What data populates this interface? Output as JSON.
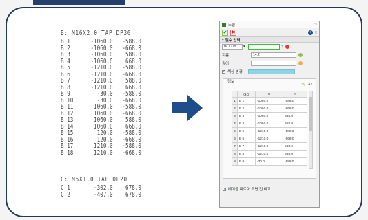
{
  "drawing": {
    "title": "B: M16X2.0 TAP DP30",
    "rows": [
      {
        "id": "B 1",
        "x": "-1060.0",
        "y": "-588.0"
      },
      {
        "id": "B 2",
        "x": "-1060.0",
        "y": "-668.0"
      },
      {
        "id": "B 3",
        "x": "-1060.0",
        "y": "588.0"
      },
      {
        "id": "B 4",
        "x": "-1060.0",
        "y": "668.0"
      },
      {
        "id": "B 5",
        "x": "-1210.0",
        "y": "-588.0"
      },
      {
        "id": "B 6",
        "x": "-1210.0",
        "y": "-668.0"
      },
      {
        "id": "B 7",
        "x": "-1210.0",
        "y": "588.0"
      },
      {
        "id": "B 8",
        "x": "-1210.0",
        "y": "668.0"
      },
      {
        "id": "B 9",
        "x": "-30.0",
        "y": "-588.0"
      },
      {
        "id": "B 10",
        "x": "-30.0",
        "y": "-668.0"
      },
      {
        "id": "B 11",
        "x": "1060.0",
        "y": "-588.0"
      },
      {
        "id": "B 12",
        "x": "1060.0",
        "y": "-668.0"
      },
      {
        "id": "B 13",
        "x": "1060.0",
        "y": "588.0"
      },
      {
        "id": "B 14",
        "x": "1060.0",
        "y": "668.0"
      },
      {
        "id": "B 15",
        "x": "120.0",
        "y": "-588.0"
      },
      {
        "id": "B 16",
        "x": "120.0",
        "y": "-668.0"
      },
      {
        "id": "B 17",
        "x": "1210.0",
        "y": "-588.0"
      },
      {
        "id": "B 18",
        "x": "1210.0",
        "y": "-668.0"
      }
    ],
    "title2": "C: M6X1.0 TAP DP20",
    "rows2": [
      {
        "id": "C 1",
        "x": "-302.0",
        "y": "678.0"
      },
      {
        "id": "C 2",
        "x": "-407.0",
        "y": "678.0"
      }
    ]
  },
  "dialog": {
    "title": "드릴",
    "section": "필수 입력",
    "type_select": "B(그X/Y",
    "depth_label": "지름",
    "depth_value": "14.2",
    "angle_label": "깊이",
    "color_label": "색상 변경",
    "info_label": "정보",
    "columns": [
      "태그",
      "X",
      "Y"
    ],
    "rows": [
      {
        "n": "1",
        "tag": "B 1",
        "x": "-1060.0",
        "y": "-588.0"
      },
      {
        "n": "2",
        "tag": "B 2",
        "x": "-1060.0",
        "y": "-668.0"
      },
      {
        "n": "3",
        "tag": "B 3",
        "x": "-1060.0",
        "y": "588.0"
      },
      {
        "n": "4",
        "tag": "B 4",
        "x": "-1060.0",
        "y": "668.0"
      },
      {
        "n": "5",
        "tag": "B 5",
        "x": "-1210.0",
        "y": "-588.0"
      },
      {
        "n": "6",
        "tag": "B 6",
        "x": "-1210.0",
        "y": "-668.0"
      },
      {
        "n": "7",
        "tag": "B 7",
        "x": "-1210.0",
        "y": "588.0"
      },
      {
        "n": "8",
        "tag": "B 8",
        "x": "-1210.0",
        "y": "668.0"
      },
      {
        "n": "9",
        "tag": "B 9",
        "x": "-30.0",
        "y": "-588.0"
      }
    ],
    "bottom_option": "데이블 파로마 도면 전 비교"
  },
  "colors": {
    "frame": "#22385c",
    "arrow": "#1e4d8c",
    "highlight": "#3bbf3b",
    "swatch": "#8fd3e8"
  }
}
